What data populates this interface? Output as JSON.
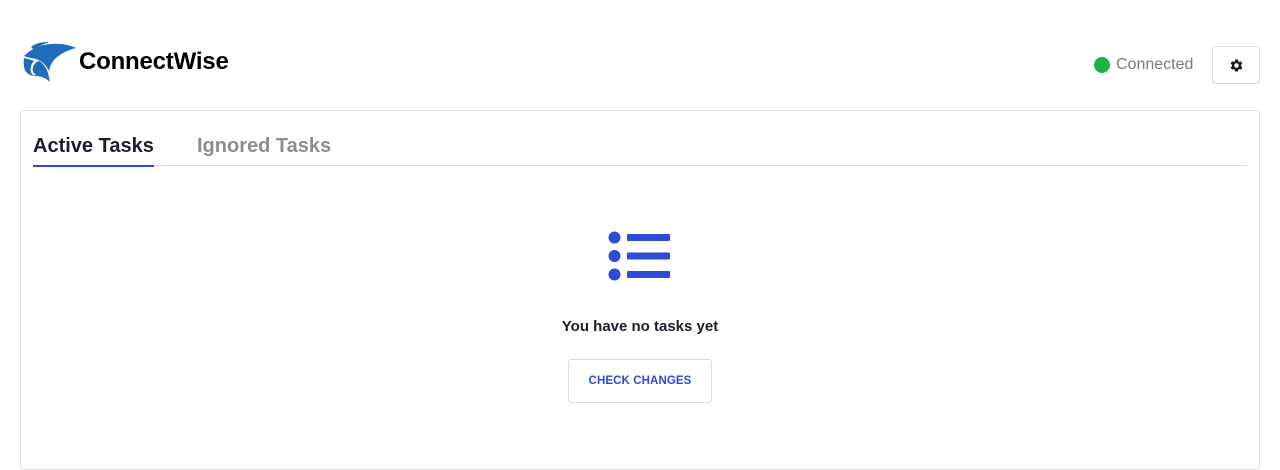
{
  "header": {
    "brand_name": "ConnectWise",
    "logo_icon": "connectwise-logo-icon",
    "status_text": "Connected",
    "status_color": "#1db249",
    "settings_icon": "gear-icon"
  },
  "tabs": [
    {
      "label": "Active Tasks",
      "active": true
    },
    {
      "label": "Ignored Tasks",
      "active": false
    }
  ],
  "empty_state": {
    "icon": "list-icon",
    "message": "You have no tasks yet",
    "button_label": "CHECK CHANGES"
  },
  "colors": {
    "accent": "#2c4bd6",
    "logo_blue": "#1f6db8",
    "text_dark": "#1b1d2a",
    "text_muted": "#8a8d93",
    "border": "#d9dbe0"
  }
}
